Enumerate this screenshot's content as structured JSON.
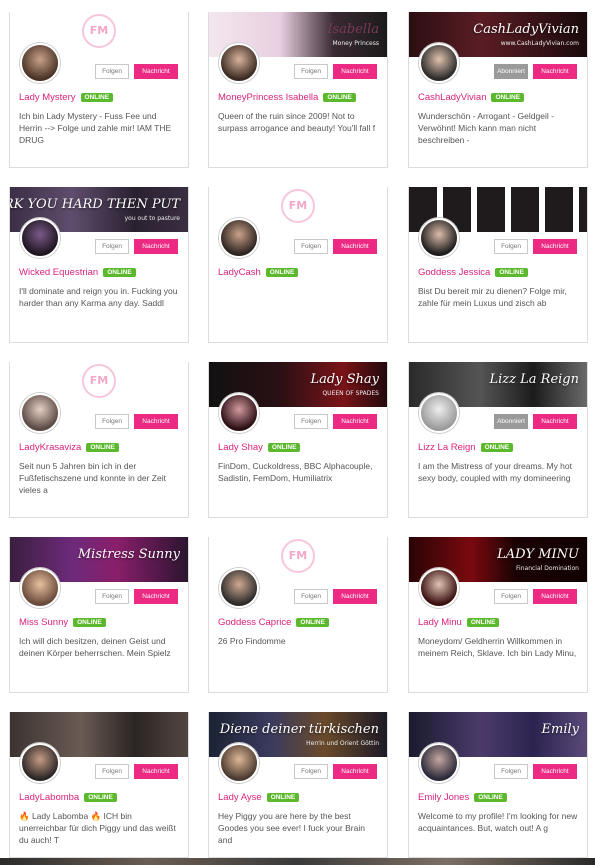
{
  "buttons": {
    "follow": "Folgen",
    "subscribed": "Abonniert",
    "message": "Nachricht"
  },
  "status_label": "ONLINE",
  "logo_text": "FM",
  "cards": [
    {
      "name": "Lady Mystery",
      "desc": "Ich bin Lady Mystery - Fuss Fee und Herrin --> Folge und zahle mir! IAM THE DRUG",
      "follow_state": "follow"
    },
    {
      "name": "MoneyPrincess Isabella",
      "desc": "Queen of the ruin since 2009! Not to surpass arrogance and beauty! You'll fall f",
      "follow_state": "follow",
      "banner_text": "Isabella",
      "banner_sub": "Money Princess"
    },
    {
      "name": "CashLadyVivian",
      "desc": "Wunderschön - Arrogant - Geldgeil - Verwöhnt! Mich kann man nicht beschreiben -",
      "follow_state": "subscribed",
      "banner_text": "CashLadyVivian",
      "banner_sub": "www.CashLadyVivian.com"
    },
    {
      "name": "Wicked Equestrian",
      "desc": "I'll dominate and reign you in. Fucking you harder than any Karma any day. Saddl",
      "follow_state": "follow",
      "banner_text": "I'LL WORK YOU HARD THEN PUT",
      "banner_sub": "you out to pasture"
    },
    {
      "name": "LadyCash",
      "desc": "",
      "follow_state": "follow"
    },
    {
      "name": "Goddess Jessica",
      "desc": "Bist Du bereit mir zu dienen? Folge mir, zahle für mein Luxus und zisch ab",
      "follow_state": "follow"
    },
    {
      "name": "LadyKrasaviza",
      "desc": "Seit nun 5 Jahren bin ich in der Fußfetischszene und konnte in der Zeit vieles a",
      "follow_state": "follow"
    },
    {
      "name": "Lady Shay",
      "desc": "FinDom, Cuckoldress, BBC Alphacouple, Sadistin, FemDom, Humiliatrix",
      "follow_state": "follow",
      "banner_text": "Lady Shay",
      "banner_sub": "QUEEN OF SPADES"
    },
    {
      "name": "Lizz La Reign",
      "desc": "I am the Mistress of your dreams. My hot sexy body, coupled with my domineering",
      "follow_state": "subscribed",
      "banner_text": "Lizz La Reign",
      "banner_sub": ""
    },
    {
      "name": "Miss Sunny",
      "desc": "Ich will dich besitzen, deinen Geist und deinen Körper beherrschen. Mein Spielz",
      "follow_state": "follow",
      "banner_text": "Mistress Sunny",
      "banner_sub": ""
    },
    {
      "name": "Goddess Caprice",
      "desc": "26 Pro Findomme",
      "follow_state": "follow"
    },
    {
      "name": "Lady Minu",
      "desc": "Moneydom/ Geldherrin Willkommen in meinem Reich, Sklave. Ich bin Lady Minu,",
      "follow_state": "follow",
      "banner_text": "LADY MINU",
      "banner_sub": "Financial Domination"
    },
    {
      "name": "LadyLabomba",
      "desc": "🔥 Lady Labomba 🔥 ICH bin unerreichbar für dich Piggy und das weißt du auch! T",
      "follow_state": "follow"
    },
    {
      "name": "Lady Ayse",
      "desc": "Hey Piggy you are here by the best Goodes you see ever! I fuck your Brain and",
      "follow_state": "follow",
      "banner_text": "Diene deiner türkischen",
      "banner_sub": "Herrin und Orient Göttin"
    },
    {
      "name": "Emily Jones",
      "desc": "Welcome to my profile! I'm looking for new acquaintances. But, watch out! A g",
      "follow_state": "follow",
      "banner_text": "Emily",
      "banner_sub": ""
    }
  ]
}
